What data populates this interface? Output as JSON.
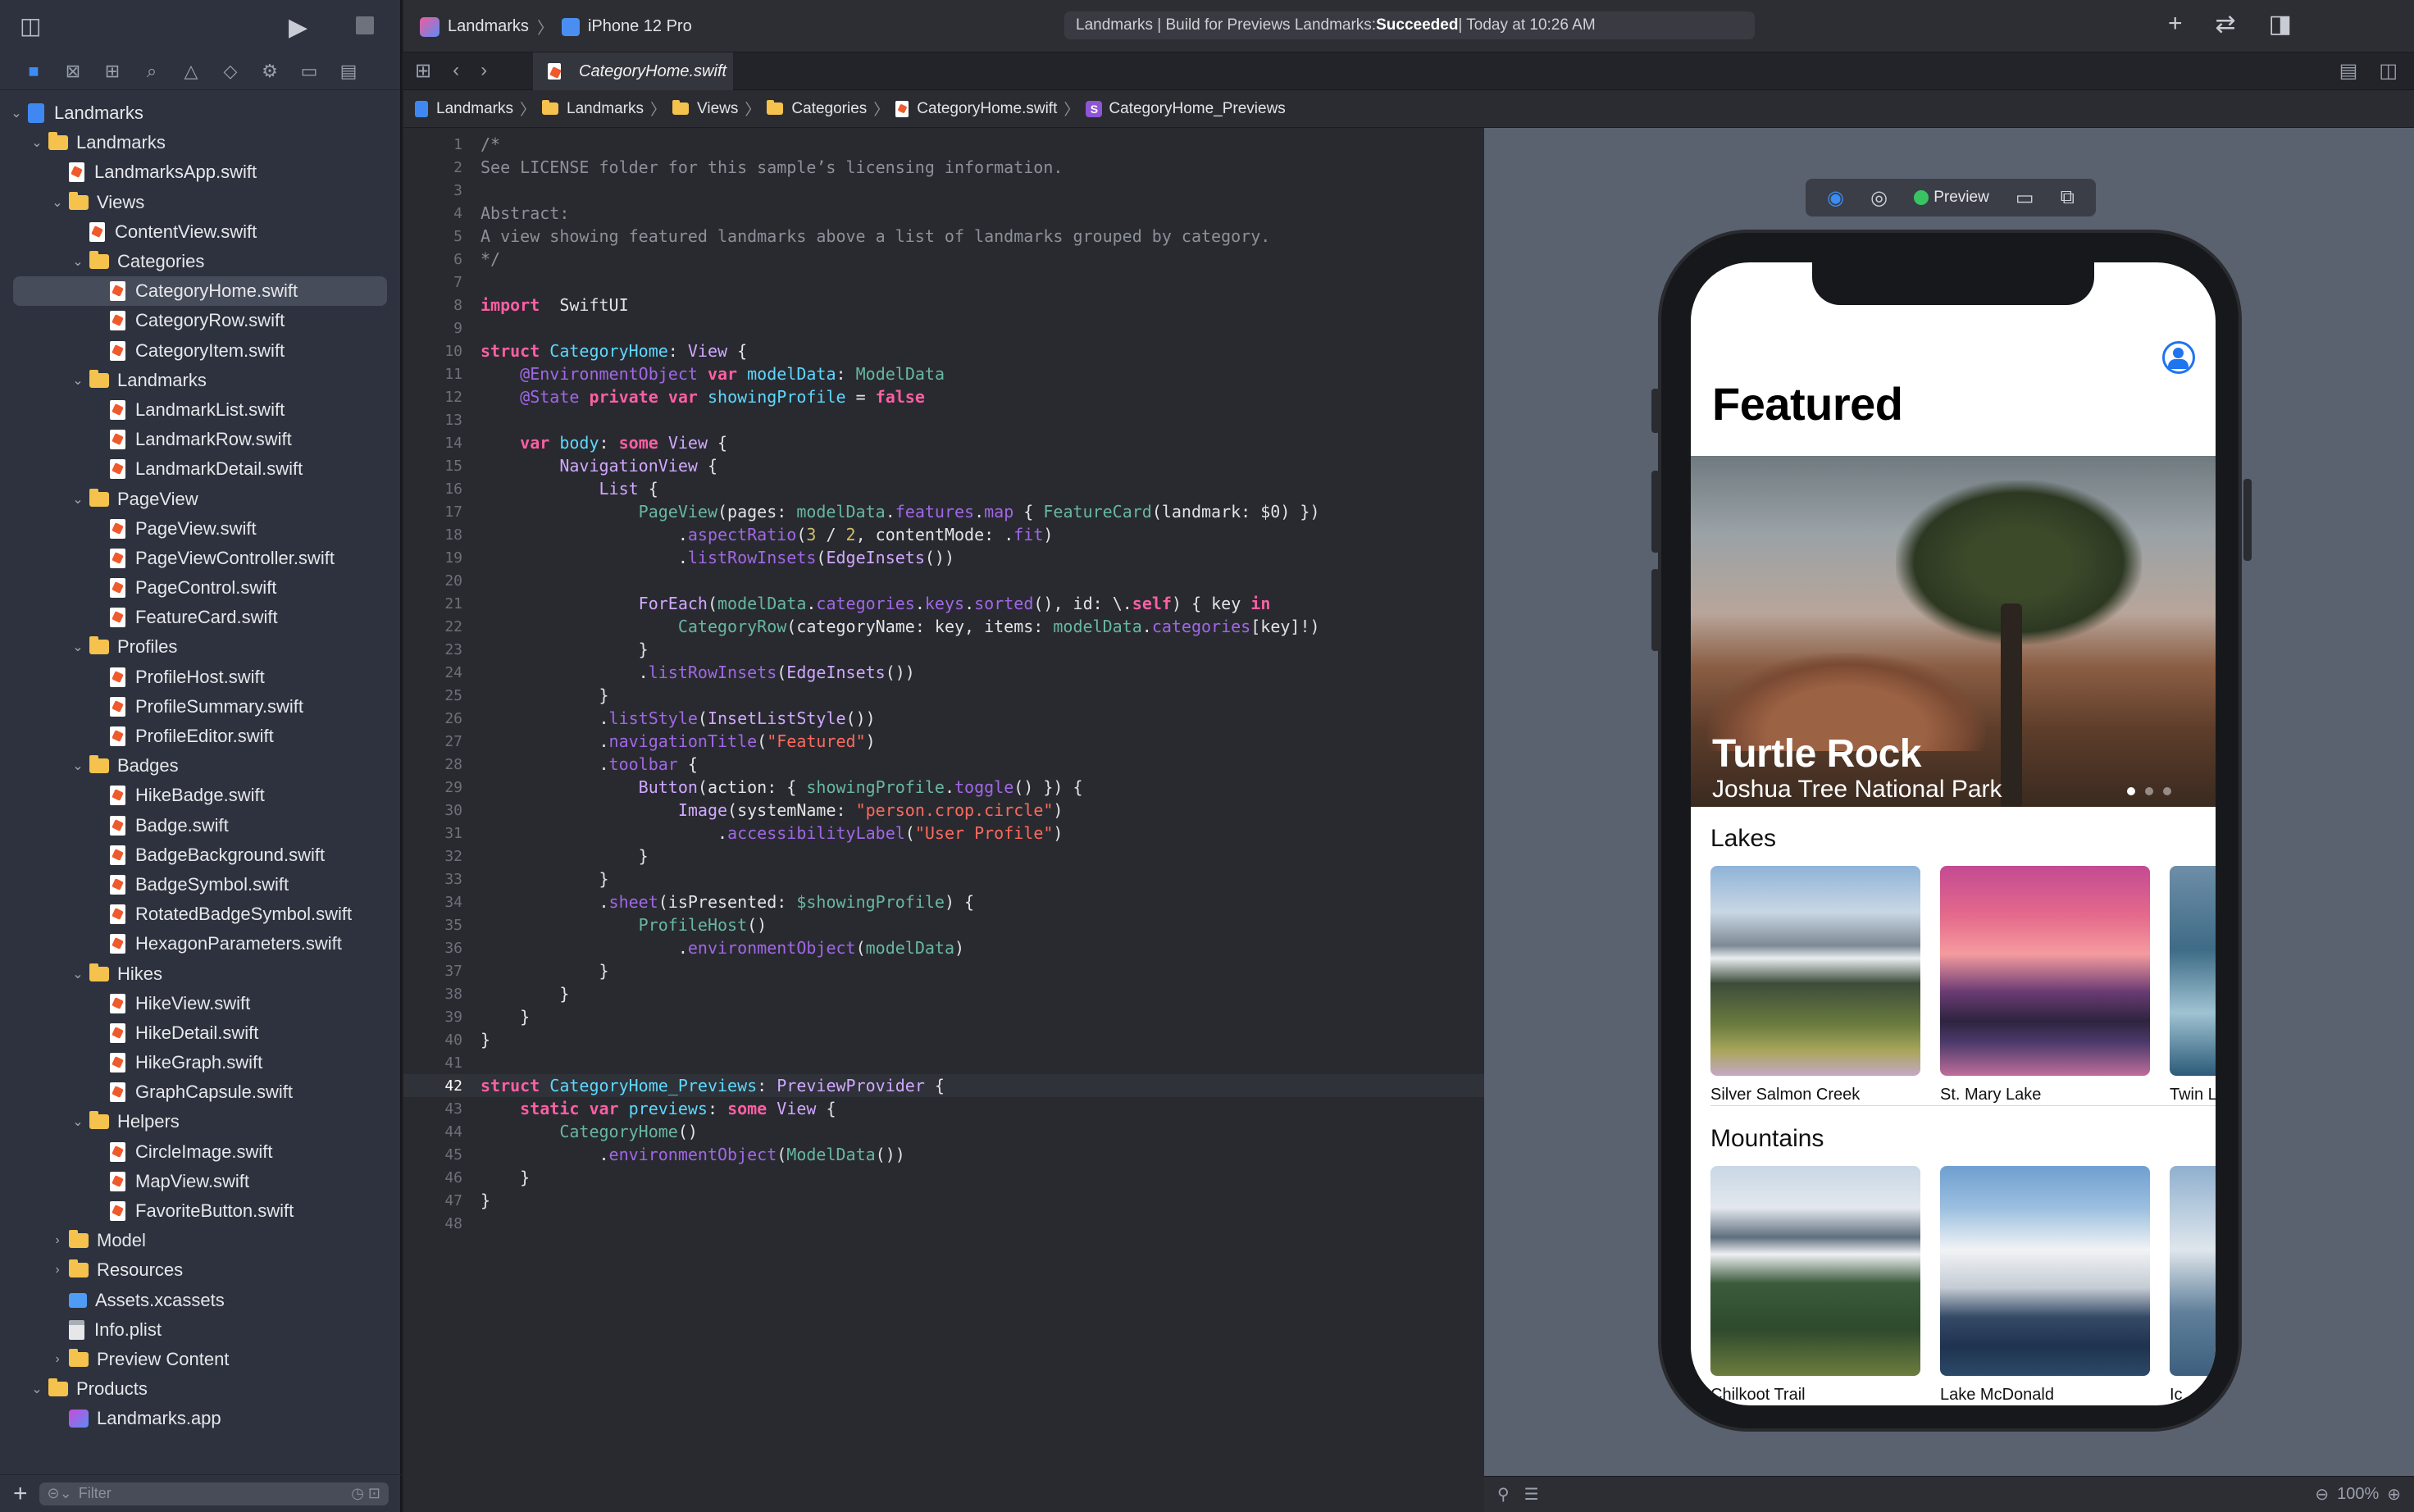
{
  "toolbar": {
    "scheme": "Landmarks",
    "device": "iPhone 12 Pro",
    "status_prefix": "Landmarks | Build for Previews Landmarks: ",
    "status_result": "Succeeded",
    "status_suffix": " | Today at 10:26 AM"
  },
  "tab": {
    "active": "CategoryHome.swift"
  },
  "breadcrumbs": [
    "Landmarks",
    "Landmarks",
    "Views",
    "Categories",
    "CategoryHome.swift",
    "CategoryHome_Previews"
  ],
  "sidebar": {
    "filter_placeholder": "Filter",
    "tree": [
      {
        "label": "Landmarks",
        "depth": 0,
        "kind": "project",
        "open": true
      },
      {
        "label": "Landmarks",
        "depth": 1,
        "kind": "folder",
        "open": true
      },
      {
        "label": "LandmarksApp.swift",
        "depth": 2,
        "kind": "swift"
      },
      {
        "label": "Views",
        "depth": 2,
        "kind": "folder",
        "open": true
      },
      {
        "label": "ContentView.swift",
        "depth": 3,
        "kind": "swift"
      },
      {
        "label": "Categories",
        "depth": 3,
        "kind": "folder",
        "open": true
      },
      {
        "label": "CategoryHome.swift",
        "depth": 4,
        "kind": "swift",
        "selected": true
      },
      {
        "label": "CategoryRow.swift",
        "depth": 4,
        "kind": "swift"
      },
      {
        "label": "CategoryItem.swift",
        "depth": 4,
        "kind": "swift"
      },
      {
        "label": "Landmarks",
        "depth": 3,
        "kind": "folder",
        "open": true
      },
      {
        "label": "LandmarkList.swift",
        "depth": 4,
        "kind": "swift"
      },
      {
        "label": "LandmarkRow.swift",
        "depth": 4,
        "kind": "swift"
      },
      {
        "label": "LandmarkDetail.swift",
        "depth": 4,
        "kind": "swift"
      },
      {
        "label": "PageView",
        "depth": 3,
        "kind": "folder",
        "open": true
      },
      {
        "label": "PageView.swift",
        "depth": 4,
        "kind": "swift"
      },
      {
        "label": "PageViewController.swift",
        "depth": 4,
        "kind": "swift"
      },
      {
        "label": "PageControl.swift",
        "depth": 4,
        "kind": "swift"
      },
      {
        "label": "FeatureCard.swift",
        "depth": 4,
        "kind": "swift"
      },
      {
        "label": "Profiles",
        "depth": 3,
        "kind": "folder",
        "open": true
      },
      {
        "label": "ProfileHost.swift",
        "depth": 4,
        "kind": "swift"
      },
      {
        "label": "ProfileSummary.swift",
        "depth": 4,
        "kind": "swift"
      },
      {
        "label": "ProfileEditor.swift",
        "depth": 4,
        "kind": "swift"
      },
      {
        "label": "Badges",
        "depth": 3,
        "kind": "folder",
        "open": true
      },
      {
        "label": "HikeBadge.swift",
        "depth": 4,
        "kind": "swift"
      },
      {
        "label": "Badge.swift",
        "depth": 4,
        "kind": "swift"
      },
      {
        "label": "BadgeBackground.swift",
        "depth": 4,
        "kind": "swift"
      },
      {
        "label": "BadgeSymbol.swift",
        "depth": 4,
        "kind": "swift"
      },
      {
        "label": "RotatedBadgeSymbol.swift",
        "depth": 4,
        "kind": "swift"
      },
      {
        "label": "HexagonParameters.swift",
        "depth": 4,
        "kind": "swift"
      },
      {
        "label": "Hikes",
        "depth": 3,
        "kind": "folder",
        "open": true
      },
      {
        "label": "HikeView.swift",
        "depth": 4,
        "kind": "swift"
      },
      {
        "label": "HikeDetail.swift",
        "depth": 4,
        "kind": "swift"
      },
      {
        "label": "HikeGraph.swift",
        "depth": 4,
        "kind": "swift"
      },
      {
        "label": "GraphCapsule.swift",
        "depth": 4,
        "kind": "swift"
      },
      {
        "label": "Helpers",
        "depth": 3,
        "kind": "folder",
        "open": true
      },
      {
        "label": "CircleImage.swift",
        "depth": 4,
        "kind": "swift"
      },
      {
        "label": "MapView.swift",
        "depth": 4,
        "kind": "swift"
      },
      {
        "label": "FavoriteButton.swift",
        "depth": 4,
        "kind": "swift"
      },
      {
        "label": "Model",
        "depth": 2,
        "kind": "folder",
        "open": false
      },
      {
        "label": "Resources",
        "depth": 2,
        "kind": "folder",
        "open": false
      },
      {
        "label": "Assets.xcassets",
        "depth": 2,
        "kind": "asset"
      },
      {
        "label": "Info.plist",
        "depth": 2,
        "kind": "plist"
      },
      {
        "label": "Preview Content",
        "depth": 2,
        "kind": "folder",
        "open": false
      },
      {
        "label": "Products",
        "depth": 1,
        "kind": "folder",
        "open": true
      },
      {
        "label": "Landmarks.app",
        "depth": 2,
        "kind": "app"
      }
    ]
  },
  "editor": {
    "current_line": 42,
    "lines": [
      [
        [
          "c",
          "/*"
        ]
      ],
      [
        [
          "c",
          "See LICENSE folder for this sample’s licensing information."
        ]
      ],
      [],
      [
        [
          "c",
          "Abstract:"
        ]
      ],
      [
        [
          "c",
          "A view showing featured landmarks above a list of landmarks grouped by category."
        ]
      ],
      [
        [
          "c",
          "*/"
        ]
      ],
      [],
      [
        [
          "k",
          "import"
        ],
        [
          "",
          "  SwiftUI"
        ]
      ],
      [],
      [
        [
          "k",
          "struct"
        ],
        [
          "",
          " "
        ],
        [
          "t",
          "CategoryHome"
        ],
        [
          "",
          ": "
        ],
        [
          "ty",
          "View"
        ],
        [
          "",
          " {"
        ]
      ],
      [
        [
          "",
          "    "
        ],
        [
          "p",
          "@EnvironmentObject"
        ],
        [
          "",
          " "
        ],
        [
          "k",
          "var"
        ],
        [
          "",
          " "
        ],
        [
          "t",
          "modelData"
        ],
        [
          "",
          ": "
        ],
        [
          "fn",
          "ModelData"
        ]
      ],
      [
        [
          "",
          "    "
        ],
        [
          "p",
          "@State"
        ],
        [
          "",
          " "
        ],
        [
          "k",
          "private"
        ],
        [
          "",
          " "
        ],
        [
          "k",
          "var"
        ],
        [
          "",
          " "
        ],
        [
          "t",
          "showingProfile"
        ],
        [
          "",
          " = "
        ],
        [
          "k",
          "false"
        ]
      ],
      [],
      [
        [
          "",
          "    "
        ],
        [
          "k",
          "var"
        ],
        [
          "",
          " "
        ],
        [
          "t",
          "body"
        ],
        [
          "",
          ": "
        ],
        [
          "k",
          "some"
        ],
        [
          "",
          " "
        ],
        [
          "ty",
          "View"
        ],
        [
          "",
          " {"
        ]
      ],
      [
        [
          "",
          "        "
        ],
        [
          "ty",
          "NavigationView"
        ],
        [
          "",
          " {"
        ]
      ],
      [
        [
          "",
          "            "
        ],
        [
          "ty",
          "List"
        ],
        [
          "",
          " {"
        ]
      ],
      [
        [
          "",
          "                "
        ],
        [
          "fn",
          "PageView"
        ],
        [
          "",
          "(pages: "
        ],
        [
          "fn",
          "modelData"
        ],
        [
          "",
          "."
        ],
        [
          "m",
          "features"
        ],
        [
          "",
          "."
        ],
        [
          "m",
          "map"
        ],
        [
          "",
          " { "
        ],
        [
          "fn",
          "FeatureCard"
        ],
        [
          "",
          "(landmark: $0) })"
        ]
      ],
      [
        [
          "",
          "                    ."
        ],
        [
          "m",
          "aspectRatio"
        ],
        [
          "",
          "("
        ],
        [
          "n",
          "3"
        ],
        [
          "",
          " / "
        ],
        [
          "n",
          "2"
        ],
        [
          "",
          ", contentMode: ."
        ],
        [
          "m",
          "fit"
        ],
        [
          "",
          ")"
        ]
      ],
      [
        [
          "",
          "                    ."
        ],
        [
          "m",
          "listRowInsets"
        ],
        [
          "",
          "("
        ],
        [
          "ty",
          "EdgeInsets"
        ],
        [
          "",
          "())"
        ]
      ],
      [],
      [
        [
          "",
          "                "
        ],
        [
          "ty",
          "ForEach"
        ],
        [
          "",
          "("
        ],
        [
          "fn",
          "modelData"
        ],
        [
          "",
          "."
        ],
        [
          "m",
          "categories"
        ],
        [
          "",
          "."
        ],
        [
          "m",
          "keys"
        ],
        [
          "",
          "."
        ],
        [
          "m",
          "sorted"
        ],
        [
          "",
          "(), id: \\."
        ],
        [
          "k",
          "self"
        ],
        [
          "",
          ") { key "
        ],
        [
          "k",
          "in"
        ]
      ],
      [
        [
          "",
          "                    "
        ],
        [
          "fn",
          "CategoryRow"
        ],
        [
          "",
          "(categoryName: key, items: "
        ],
        [
          "fn",
          "modelData"
        ],
        [
          "",
          "."
        ],
        [
          "m",
          "categories"
        ],
        [
          "",
          "[key]!)"
        ]
      ],
      [
        [
          "",
          "                }"
        ]
      ],
      [
        [
          "",
          "                ."
        ],
        [
          "m",
          "listRowInsets"
        ],
        [
          "",
          "("
        ],
        [
          "ty",
          "EdgeInsets"
        ],
        [
          "",
          "())"
        ]
      ],
      [
        [
          "",
          "            }"
        ]
      ],
      [
        [
          "",
          "            ."
        ],
        [
          "m",
          "listStyle"
        ],
        [
          "",
          "("
        ],
        [
          "ty",
          "InsetListStyle"
        ],
        [
          "",
          "())"
        ]
      ],
      [
        [
          "",
          "            ."
        ],
        [
          "m",
          "navigationTitle"
        ],
        [
          "",
          "("
        ],
        [
          "s",
          "\"Featured\""
        ],
        [
          "",
          ")"
        ]
      ],
      [
        [
          "",
          "            ."
        ],
        [
          "m",
          "toolbar"
        ],
        [
          "",
          " {"
        ]
      ],
      [
        [
          "",
          "                "
        ],
        [
          "ty",
          "Button"
        ],
        [
          "",
          "(action: { "
        ],
        [
          "fn",
          "showingProfile"
        ],
        [
          "",
          "."
        ],
        [
          "m",
          "toggle"
        ],
        [
          "",
          "() }) {"
        ]
      ],
      [
        [
          "",
          "                    "
        ],
        [
          "ty",
          "Image"
        ],
        [
          "",
          "(systemName: "
        ],
        [
          "s",
          "\"person.crop.circle\""
        ],
        [
          "",
          ")"
        ]
      ],
      [
        [
          "",
          "                        ."
        ],
        [
          "m",
          "accessibilityLabel"
        ],
        [
          "",
          "("
        ],
        [
          "s",
          "\"User Profile\""
        ],
        [
          "",
          ")"
        ]
      ],
      [
        [
          "",
          "                }"
        ]
      ],
      [
        [
          "",
          "            }"
        ]
      ],
      [
        [
          "",
          "            ."
        ],
        [
          "m",
          "sheet"
        ],
        [
          "",
          "(isPresented: "
        ],
        [
          "fn",
          "$showingProfile"
        ],
        [
          "",
          ") {"
        ]
      ],
      [
        [
          "",
          "                "
        ],
        [
          "fn",
          "ProfileHost"
        ],
        [
          "",
          "()"
        ]
      ],
      [
        [
          "",
          "                    ."
        ],
        [
          "m",
          "environmentObject"
        ],
        [
          "",
          "("
        ],
        [
          "fn",
          "modelData"
        ],
        [
          "",
          ")"
        ]
      ],
      [
        [
          "",
          "            }"
        ]
      ],
      [
        [
          "",
          "        }"
        ]
      ],
      [
        [
          "",
          "    }"
        ]
      ],
      [
        [
          "",
          "}"
        ]
      ],
      [],
      [
        [
          "k",
          "struct"
        ],
        [
          "",
          " "
        ],
        [
          "t",
          "CategoryHome_Previews"
        ],
        [
          "",
          ": "
        ],
        [
          "ty",
          "PreviewProvider"
        ],
        [
          "",
          " {"
        ]
      ],
      [
        [
          "",
          "    "
        ],
        [
          "k",
          "static"
        ],
        [
          "",
          " "
        ],
        [
          "k",
          "var"
        ],
        [
          "",
          " "
        ],
        [
          "t",
          "previews"
        ],
        [
          "",
          ": "
        ],
        [
          "k",
          "some"
        ],
        [
          "",
          " "
        ],
        [
          "ty",
          "View"
        ],
        [
          "",
          " {"
        ]
      ],
      [
        [
          "",
          "        "
        ],
        [
          "fn",
          "CategoryHome"
        ],
        [
          "",
          "()"
        ]
      ],
      [
        [
          "",
          "            ."
        ],
        [
          "m",
          "environmentObject"
        ],
        [
          "",
          "("
        ],
        [
          "fn",
          "ModelData"
        ],
        [
          "",
          "())"
        ]
      ],
      [
        [
          "",
          "    }"
        ]
      ],
      [
        [
          "",
          "}"
        ]
      ],
      []
    ]
  },
  "preview": {
    "label": "Preview",
    "zoom": "100%",
    "nav_title": "Featured",
    "feature_title": "Turtle Rock",
    "feature_subtitle": "Joshua Tree National Park",
    "page_count": 3,
    "page_index": 0,
    "categories": [
      {
        "name": "Lakes",
        "items": [
          "Silver Salmon Creek",
          "St. Mary Lake",
          "Twin L"
        ]
      },
      {
        "name": "Mountains",
        "items": [
          "Chilkoot Trail",
          "Lake McDonald",
          "Ic"
        ]
      }
    ]
  },
  "colors": {
    "accent": "#3b8cf5",
    "keyword": "#fc5fa3",
    "string": "#fc6a5d",
    "success": "#39c463"
  }
}
